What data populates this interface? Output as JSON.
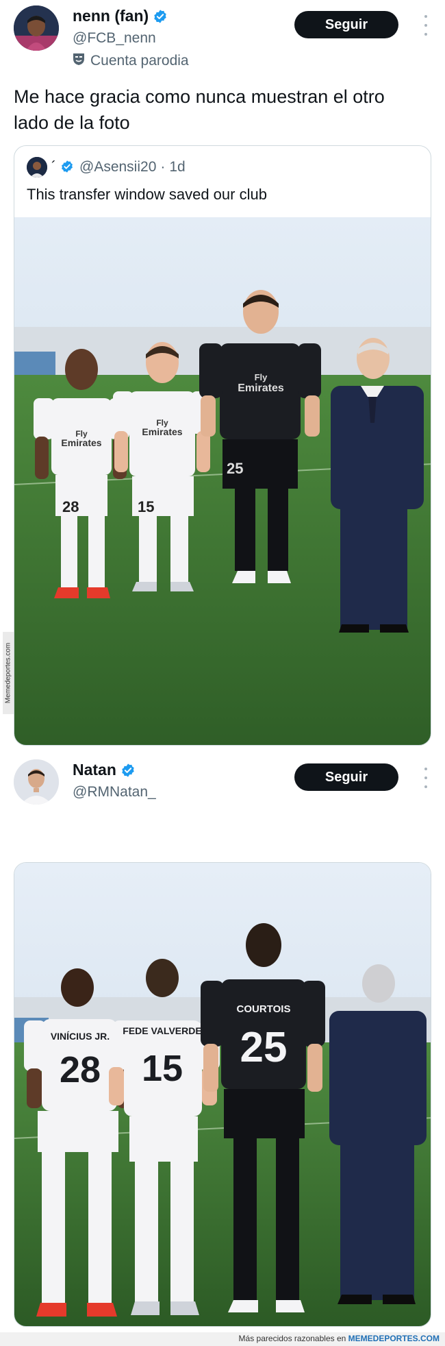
{
  "tweet1": {
    "display_name": "nenn (fan)",
    "handle": "@FCB_nenn",
    "parody_label": "Cuenta parodia",
    "follow_label": "Seguir",
    "text": "Me hace gracia como nunca muestran el otro lado de la foto"
  },
  "quote": {
    "name_glyph": "´",
    "handle": "@Asensii20",
    "separator": "·",
    "time": "1d",
    "text": "This transfer window saved our club"
  },
  "tweet2": {
    "display_name": "Natan",
    "handle": "@RMNatan_",
    "follow_label": "Seguir"
  },
  "photo_front": {
    "sponsor_top": "Fly",
    "sponsor_bottom": "Emirates",
    "numbers": [
      "28",
      "15",
      "25"
    ]
  },
  "photo_back": {
    "players": [
      {
        "name": "VINÍCIUS JR.",
        "number": "28"
      },
      {
        "name": "FEDE VALVERDE",
        "number": "15"
      },
      {
        "name": "COURTOIS",
        "number": "25"
      }
    ]
  },
  "watermark": {
    "side_text": "Memedeportes.com",
    "footer_prefix": "Más parecidos razonables en",
    "footer_brand": "MEMEDEPORTES.COM"
  },
  "colors": {
    "verified": "#1d9bf0",
    "follow_bg": "#0f1419",
    "kit_white": "#f4f4f6",
    "kit_black": "#1b1d22",
    "pitch_green": "#3f7a35"
  },
  "icons": [
    "verified-badge-icon",
    "parody-mask-icon",
    "more-options-icon"
  ]
}
